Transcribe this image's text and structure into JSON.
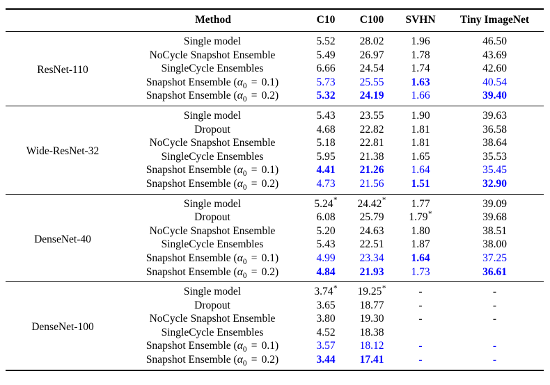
{
  "table": {
    "columns": [
      "",
      "Method",
      "C10",
      "C100",
      "SVHN",
      "Tiny ImageNet"
    ],
    "header": {
      "group": "",
      "method": "Method",
      "c10": "C10",
      "c100": "C100",
      "svhn": "SVHN",
      "tiny": "Tiny ImageNet"
    },
    "accent_blue": "#0000FF",
    "text_color": "#000000",
    "blocks": [
      {
        "group": "ResNet-110",
        "rows": [
          {
            "method": "Single model",
            "method_parts": {
              "prefix": "Single model",
              "alpha": null
            },
            "c10": "5.52",
            "c100": "28.02",
            "svhn": "1.96",
            "tiny": "46.50",
            "blue": false,
            "bold": {
              "c10": false,
              "c100": false,
              "svhn": false,
              "tiny": false
            },
            "star": {
              "c10": false,
              "c100": false,
              "svhn": false,
              "tiny": false
            }
          },
          {
            "method": "NoCycle Snapshot Ensemble",
            "method_parts": {
              "prefix": "NoCycle Snapshot Ensemble",
              "alpha": null
            },
            "c10": "5.49",
            "c100": "26.97",
            "svhn": "1.78",
            "tiny": "43.69",
            "blue": false,
            "bold": {
              "c10": false,
              "c100": false,
              "svhn": false,
              "tiny": false
            },
            "star": {
              "c10": false,
              "c100": false,
              "svhn": false,
              "tiny": false
            }
          },
          {
            "method": "SingleCycle Ensembles",
            "method_parts": {
              "prefix": "SingleCycle Ensembles",
              "alpha": null
            },
            "c10": "6.66",
            "c100": "24.54",
            "svhn": "1.74",
            "tiny": "42.60",
            "blue": false,
            "bold": {
              "c10": false,
              "c100": false,
              "svhn": false,
              "tiny": false
            },
            "star": {
              "c10": false,
              "c100": false,
              "svhn": false,
              "tiny": false
            }
          },
          {
            "method": "Snapshot Ensemble (α0 = 0.1)",
            "method_parts": {
              "prefix": "Snapshot Ensemble (",
              "alpha": "0.1"
            },
            "c10": "5.73",
            "c100": "25.55",
            "svhn": "1.63",
            "tiny": "40.54",
            "blue": true,
            "bold": {
              "c10": false,
              "c100": false,
              "svhn": true,
              "tiny": false
            },
            "star": {
              "c10": false,
              "c100": false,
              "svhn": false,
              "tiny": false
            }
          },
          {
            "method": "Snapshot Ensemble (α0 = 0.2)",
            "method_parts": {
              "prefix": "Snapshot Ensemble (",
              "alpha": "0.2"
            },
            "c10": "5.32",
            "c100": "24.19",
            "svhn": "1.66",
            "tiny": "39.40",
            "blue": true,
            "bold": {
              "c10": true,
              "c100": true,
              "svhn": false,
              "tiny": true
            },
            "star": {
              "c10": false,
              "c100": false,
              "svhn": false,
              "tiny": false
            }
          }
        ]
      },
      {
        "group": "Wide-ResNet-32",
        "rows": [
          {
            "method": "Single model",
            "method_parts": {
              "prefix": "Single model",
              "alpha": null
            },
            "c10": "5.43",
            "c100": "23.55",
            "svhn": "1.90",
            "tiny": "39.63",
            "blue": false,
            "bold": {
              "c10": false,
              "c100": false,
              "svhn": false,
              "tiny": false
            },
            "star": {
              "c10": false,
              "c100": false,
              "svhn": false,
              "tiny": false
            }
          },
          {
            "method": "Dropout",
            "method_parts": {
              "prefix": "Dropout",
              "alpha": null
            },
            "c10": "4.68",
            "c100": "22.82",
            "svhn": "1.81",
            "tiny": "36.58",
            "blue": false,
            "bold": {
              "c10": false,
              "c100": false,
              "svhn": false,
              "tiny": false
            },
            "star": {
              "c10": false,
              "c100": false,
              "svhn": false,
              "tiny": false
            }
          },
          {
            "method": "NoCycle Snapshot Ensemble",
            "method_parts": {
              "prefix": "NoCycle Snapshot Ensemble",
              "alpha": null
            },
            "c10": "5.18",
            "c100": "22.81",
            "svhn": "1.81",
            "tiny": "38.64",
            "blue": false,
            "bold": {
              "c10": false,
              "c100": false,
              "svhn": false,
              "tiny": false
            },
            "star": {
              "c10": false,
              "c100": false,
              "svhn": false,
              "tiny": false
            }
          },
          {
            "method": "SingleCycle Ensembles",
            "method_parts": {
              "prefix": "SingleCycle Ensembles",
              "alpha": null
            },
            "c10": "5.95",
            "c100": "21.38",
            "svhn": "1.65",
            "tiny": "35.53",
            "blue": false,
            "bold": {
              "c10": false,
              "c100": false,
              "svhn": false,
              "tiny": false
            },
            "star": {
              "c10": false,
              "c100": false,
              "svhn": false,
              "tiny": false
            }
          },
          {
            "method": "Snapshot Ensemble (α0 = 0.1)",
            "method_parts": {
              "prefix": "Snapshot Ensemble (",
              "alpha": "0.1"
            },
            "c10": "4.41",
            "c100": "21.26",
            "svhn": "1.64",
            "tiny": "35.45",
            "blue": true,
            "bold": {
              "c10": true,
              "c100": true,
              "svhn": false,
              "tiny": false
            },
            "star": {
              "c10": false,
              "c100": false,
              "svhn": false,
              "tiny": false
            }
          },
          {
            "method": "Snapshot Ensemble (α0 = 0.2)",
            "method_parts": {
              "prefix": "Snapshot Ensemble (",
              "alpha": "0.2"
            },
            "c10": "4.73",
            "c100": "21.56",
            "svhn": "1.51",
            "tiny": "32.90",
            "blue": true,
            "bold": {
              "c10": false,
              "c100": false,
              "svhn": true,
              "tiny": true
            },
            "star": {
              "c10": false,
              "c100": false,
              "svhn": false,
              "tiny": false
            }
          }
        ]
      },
      {
        "group": "DenseNet-40",
        "rows": [
          {
            "method": "Single model",
            "method_parts": {
              "prefix": "Single model",
              "alpha": null
            },
            "c10": "5.24",
            "c100": "24.42",
            "svhn": "1.77",
            "tiny": "39.09",
            "blue": false,
            "bold": {
              "c10": false,
              "c100": false,
              "svhn": false,
              "tiny": false
            },
            "star": {
              "c10": true,
              "c100": true,
              "svhn": false,
              "tiny": false
            }
          },
          {
            "method": "Dropout",
            "method_parts": {
              "prefix": "Dropout",
              "alpha": null
            },
            "c10": "6.08",
            "c100": "25.79",
            "svhn": "1.79",
            "tiny": "39.68",
            "blue": false,
            "bold": {
              "c10": false,
              "c100": false,
              "svhn": false,
              "tiny": false
            },
            "star": {
              "c10": false,
              "c100": false,
              "svhn": true,
              "tiny": false
            }
          },
          {
            "method": "NoCycle Snapshot Ensemble",
            "method_parts": {
              "prefix": "NoCycle Snapshot Ensemble",
              "alpha": null
            },
            "c10": "5.20",
            "c100": "24.63",
            "svhn": "1.80",
            "tiny": "38.51",
            "blue": false,
            "bold": {
              "c10": false,
              "c100": false,
              "svhn": false,
              "tiny": false
            },
            "star": {
              "c10": false,
              "c100": false,
              "svhn": false,
              "tiny": false
            }
          },
          {
            "method": "SingleCycle Ensembles",
            "method_parts": {
              "prefix": "SingleCycle Ensembles",
              "alpha": null
            },
            "c10": "5.43",
            "c100": "22.51",
            "svhn": "1.87",
            "tiny": "38.00",
            "blue": false,
            "bold": {
              "c10": false,
              "c100": false,
              "svhn": false,
              "tiny": false
            },
            "star": {
              "c10": false,
              "c100": false,
              "svhn": false,
              "tiny": false
            }
          },
          {
            "method": "Snapshot Ensemble (α0 = 0.1)",
            "method_parts": {
              "prefix": "Snapshot Ensemble (",
              "alpha": "0.1"
            },
            "c10": "4.99",
            "c100": "23.34",
            "svhn": "1.64",
            "tiny": "37.25",
            "blue": true,
            "bold": {
              "c10": false,
              "c100": false,
              "svhn": true,
              "tiny": false
            },
            "star": {
              "c10": false,
              "c100": false,
              "svhn": false,
              "tiny": false
            }
          },
          {
            "method": "Snapshot Ensemble (α0 = 0.2)",
            "method_parts": {
              "prefix": "Snapshot Ensemble (",
              "alpha": "0.2"
            },
            "c10": "4.84",
            "c100": "21.93",
            "svhn": "1.73",
            "tiny": "36.61",
            "blue": true,
            "bold": {
              "c10": true,
              "c100": true,
              "svhn": false,
              "tiny": true
            },
            "star": {
              "c10": false,
              "c100": false,
              "svhn": false,
              "tiny": false
            }
          }
        ]
      },
      {
        "group": "DenseNet-100",
        "rows": [
          {
            "method": "Single model",
            "method_parts": {
              "prefix": "Single model",
              "alpha": null
            },
            "c10": "3.74",
            "c100": "19.25",
            "svhn": "-",
            "tiny": "-",
            "blue": false,
            "bold": {
              "c10": false,
              "c100": false,
              "svhn": false,
              "tiny": false
            },
            "star": {
              "c10": true,
              "c100": true,
              "svhn": false,
              "tiny": false
            }
          },
          {
            "method": "Dropout",
            "method_parts": {
              "prefix": "Dropout",
              "alpha": null
            },
            "c10": "3.65",
            "c100": "18.77",
            "svhn": "-",
            "tiny": "-",
            "blue": false,
            "bold": {
              "c10": false,
              "c100": false,
              "svhn": false,
              "tiny": false
            },
            "star": {
              "c10": false,
              "c100": false,
              "svhn": false,
              "tiny": false
            }
          },
          {
            "method": "NoCycle Snapshot Ensemble",
            "method_parts": {
              "prefix": "NoCycle Snapshot Ensemble",
              "alpha": null
            },
            "c10": "3.80",
            "c100": "19.30",
            "svhn": "-",
            "tiny": "-",
            "blue": false,
            "bold": {
              "c10": false,
              "c100": false,
              "svhn": false,
              "tiny": false
            },
            "star": {
              "c10": false,
              "c100": false,
              "svhn": false,
              "tiny": false
            }
          },
          {
            "method": "SingleCycle Ensembles",
            "method_parts": {
              "prefix": "SingleCycle Ensembles",
              "alpha": null
            },
            "c10": "4.52",
            "c100": "18.38",
            "svhn": "",
            "tiny": "",
            "blue": false,
            "bold": {
              "c10": false,
              "c100": false,
              "svhn": false,
              "tiny": false
            },
            "star": {
              "c10": false,
              "c100": false,
              "svhn": false,
              "tiny": false
            }
          },
          {
            "method": "Snapshot Ensemble (α0 = 0.1)",
            "method_parts": {
              "prefix": "Snapshot Ensemble (",
              "alpha": "0.1"
            },
            "c10": "3.57",
            "c100": "18.12",
            "svhn": "-",
            "tiny": "-",
            "blue": true,
            "bold": {
              "c10": false,
              "c100": false,
              "svhn": false,
              "tiny": false
            },
            "star": {
              "c10": false,
              "c100": false,
              "svhn": false,
              "tiny": false
            }
          },
          {
            "method": "Snapshot Ensemble (α0 = 0.2)",
            "method_parts": {
              "prefix": "Snapshot Ensemble (",
              "alpha": "0.2"
            },
            "c10": "3.44",
            "c100": "17.41",
            "svhn": "-",
            "tiny": "-",
            "blue": true,
            "bold": {
              "c10": true,
              "c100": true,
              "svhn": false,
              "tiny": false
            },
            "star": {
              "c10": false,
              "c100": false,
              "svhn": false,
              "tiny": false
            }
          }
        ]
      }
    ]
  }
}
